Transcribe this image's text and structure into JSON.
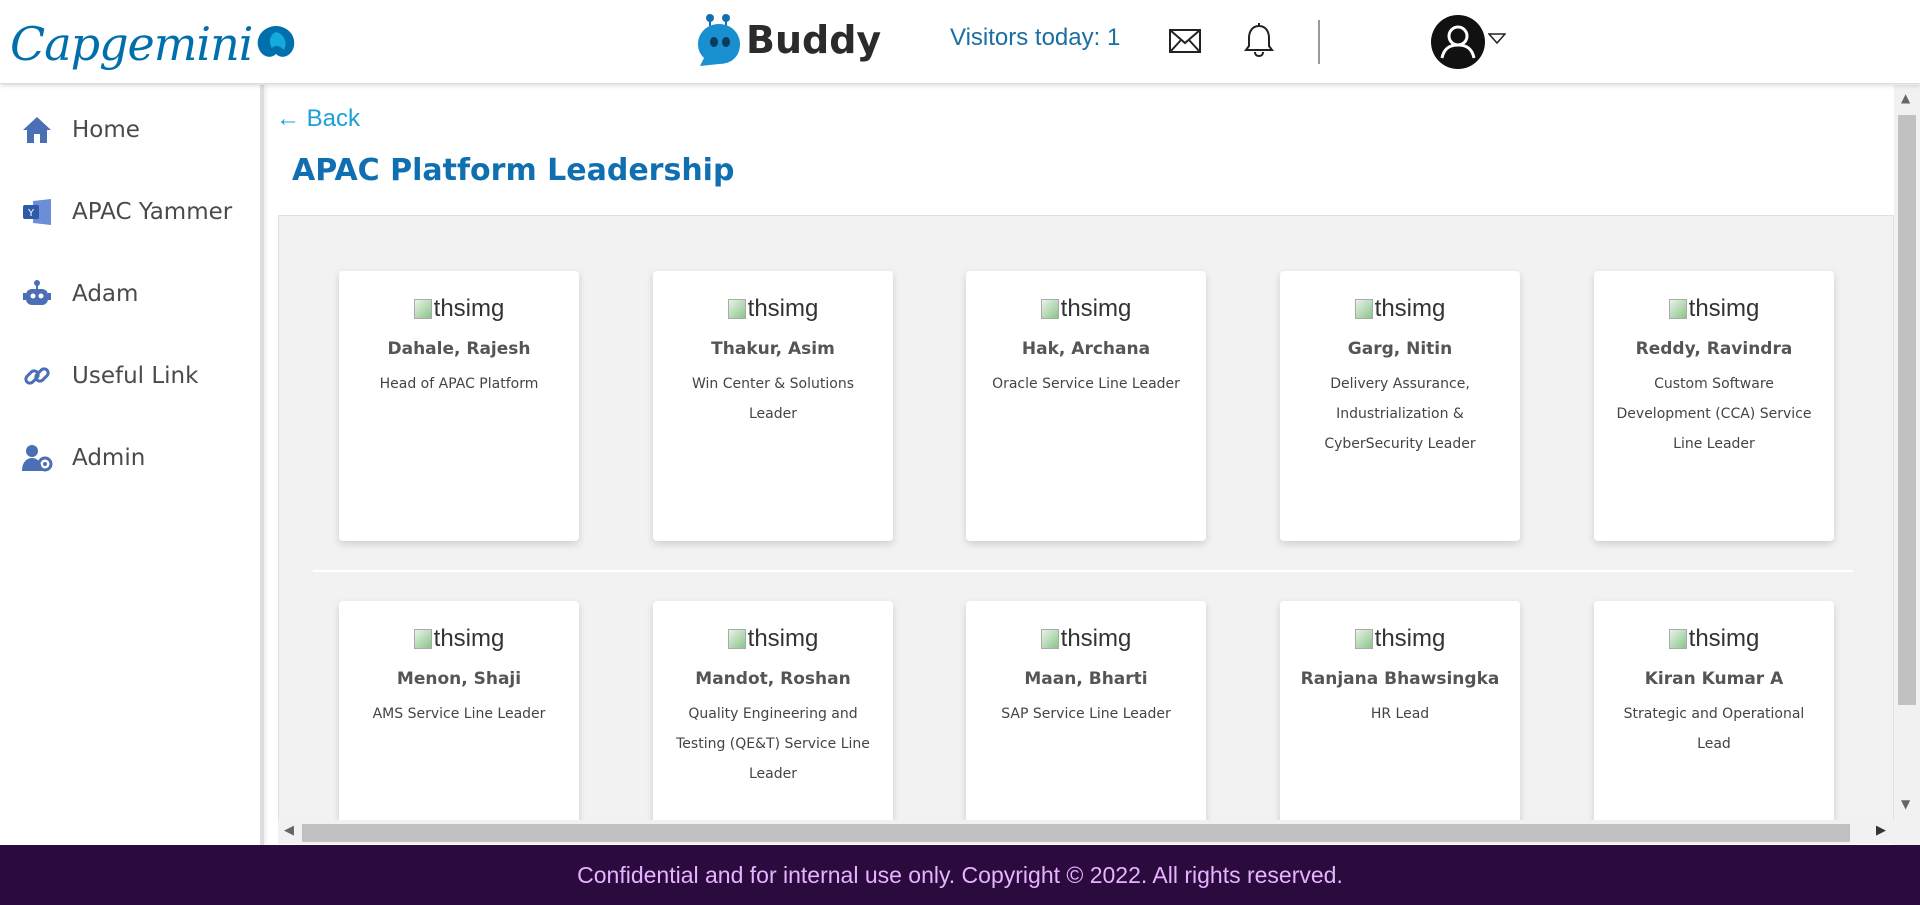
{
  "header": {
    "logo_text": "Capgemini",
    "app_name": "Buddy",
    "visitors": "Visitors today: 1",
    "colors": {
      "brand": "#0070ad",
      "link": "#1aa0d8",
      "footer_bg": "#2b0a3d"
    }
  },
  "sidebar": {
    "items": [
      {
        "label": "Home",
        "icon": "home-icon"
      },
      {
        "label": "APAC Yammer",
        "icon": "yammer-icon"
      },
      {
        "label": "Adam",
        "icon": "robot-icon"
      },
      {
        "label": "Useful Link",
        "icon": "link-icon"
      },
      {
        "label": "Admin",
        "icon": "admin-icon"
      }
    ]
  },
  "main": {
    "back_label": "← Back",
    "title": "APAC Platform Leadership",
    "img_alt": "thsimg",
    "cards": [
      {
        "name": "Dahale, Rajesh",
        "role": "Head of APAC Platform"
      },
      {
        "name": "Thakur, Asim",
        "role": "Win Center & Solutions Leader"
      },
      {
        "name": "Hak, Archana",
        "role": "Oracle Service Line Leader"
      },
      {
        "name": "Garg, Nitin",
        "role": "Delivery Assurance, Industrialization & CyberSecurity Leader"
      },
      {
        "name": "Reddy, Ravindra",
        "role": "Custom Software Development (CCA) Service Line Leader"
      },
      {
        "name": "Menon, Shaji",
        "role": "AMS Service Line Leader"
      },
      {
        "name": "Mandot, Roshan",
        "role": "Quality Engineering and Testing (QE&T) Service Line Leader"
      },
      {
        "name": "Maan, Bharti",
        "role": "SAP Service Line Leader"
      },
      {
        "name": "Ranjana Bhawsingka",
        "role": "HR Lead"
      },
      {
        "name": "Kiran Kumar A",
        "role": "Strategic and Operational Lead"
      }
    ]
  },
  "footer": {
    "text": "Confidential and for internal use only. Copyright © 2022. All rights reserved."
  }
}
